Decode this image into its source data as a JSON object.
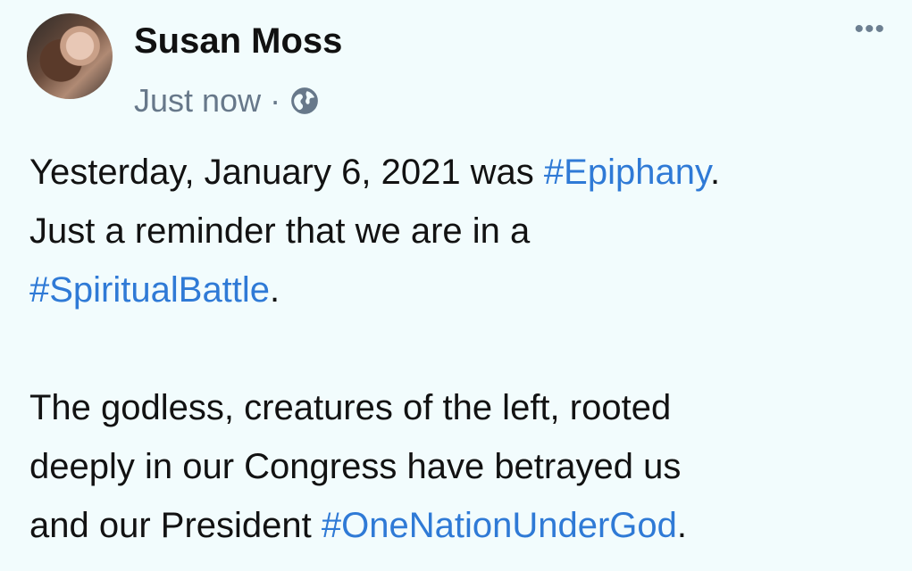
{
  "post": {
    "author": "Susan Moss",
    "timestamp": "Just now",
    "separator": "·",
    "privacy_icon": "globe-icon",
    "more_icon": "more-dots-icon",
    "more_glyph": "•••",
    "paragraph1": {
      "t1": "Yesterday, January 6, 2021 was ",
      "h1": "#Epiphany",
      "t2": ".",
      "t3": "Just a reminder that we are in a",
      "h2": "#SpiritualBattle",
      "t4": "."
    },
    "paragraph2": {
      "t1": "The godless, creatures of the left, rooted",
      "t2": "deeply in our Congress have betrayed us",
      "t3": "and our President ",
      "h1": "#OneNationUnderGod",
      "t4": "."
    }
  },
  "colors": {
    "background": "#f2fcfd",
    "hashtag": "#2f7ad6",
    "meta": "#67788a"
  }
}
